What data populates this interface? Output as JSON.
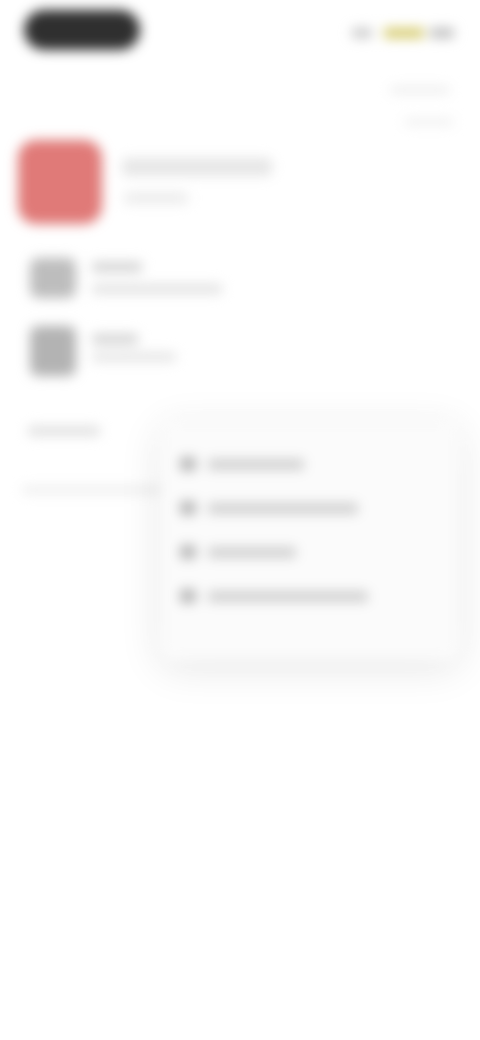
{
  "status_bar": {
    "indicators": [
      "signal-icon",
      "wifi-icon",
      "battery-icon"
    ]
  },
  "colors": {
    "app_icon": "#e07a78",
    "status_pill": "#2f2f2f",
    "status_accent": "#d4c96a"
  },
  "app": {
    "name": "",
    "subtitle": ""
  },
  "notifications": [
    {
      "icon": "app-icon",
      "title": "",
      "text": ""
    },
    {
      "icon": "app-icon",
      "title": "",
      "text": ""
    }
  ],
  "section": {
    "label": ""
  },
  "menu": {
    "items": [
      {
        "icon": "menu-icon",
        "label": ""
      },
      {
        "icon": "menu-icon",
        "label": ""
      },
      {
        "icon": "menu-icon",
        "label": ""
      },
      {
        "icon": "menu-icon",
        "label": ""
      }
    ]
  }
}
